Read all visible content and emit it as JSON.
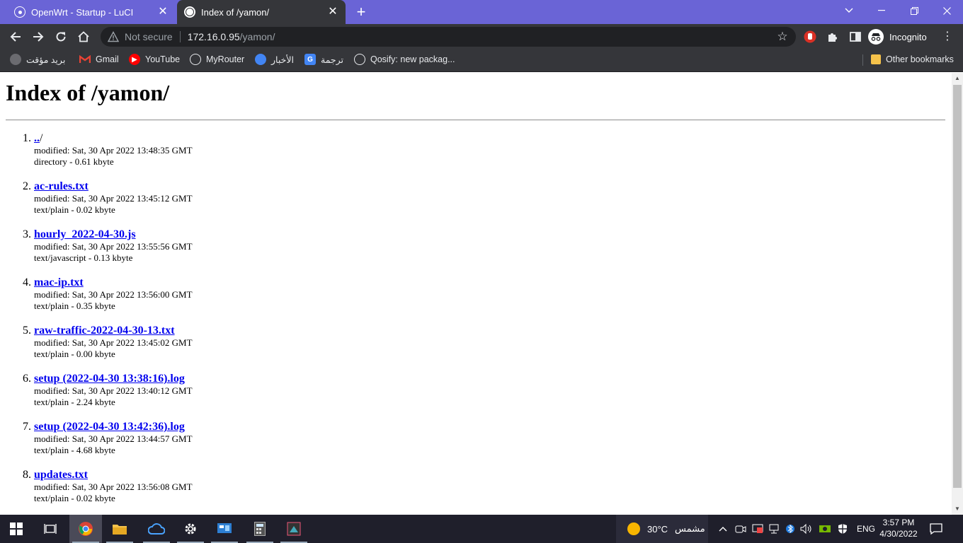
{
  "browser": {
    "tabs": [
      {
        "title": "OpenWrt - Startup - LuCI",
        "active": false
      },
      {
        "title": "Index of /yamon/",
        "active": true
      }
    ],
    "address": {
      "security": "Not secure",
      "host": "172.16.0.95",
      "path": "/yamon/"
    },
    "profile": "Incognito",
    "bookmarks": [
      {
        "label": "بريد مؤقت",
        "icon": "globe-icon"
      },
      {
        "label": "Gmail",
        "icon": "gmail-icon"
      },
      {
        "label": "YouTube",
        "icon": "youtube-icon"
      },
      {
        "label": "MyRouter",
        "icon": "router-icon"
      },
      {
        "label": "الأخبار",
        "icon": "news-icon"
      },
      {
        "label": "ترجمة",
        "icon": "translate-icon"
      },
      {
        "label": "Qosify: new packag...",
        "icon": "openwrt-icon"
      }
    ],
    "other_bookmarks": "Other bookmarks"
  },
  "page": {
    "title": "Index of /yamon/",
    "entries": [
      {
        "num": "1.",
        "name": "..",
        "suffix": "/",
        "modified": "modified: Sat, 30 Apr 2022 13:48:35 GMT",
        "info": "directory - 0.61 kbyte"
      },
      {
        "num": "2.",
        "name": "ac-rules.txt",
        "suffix": "",
        "modified": "modified: Sat, 30 Apr 2022 13:45:12 GMT",
        "info": "text/plain - 0.02 kbyte"
      },
      {
        "num": "3.",
        "name": "hourly_2022-04-30.js",
        "suffix": "",
        "modified": "modified: Sat, 30 Apr 2022 13:55:56 GMT",
        "info": "text/javascript - 0.13 kbyte"
      },
      {
        "num": "4.",
        "name": "mac-ip.txt",
        "suffix": "",
        "modified": "modified: Sat, 30 Apr 2022 13:56:00 GMT",
        "info": "text/plain - 0.35 kbyte"
      },
      {
        "num": "5.",
        "name": "raw-traffic-2022-04-30-13.txt",
        "suffix": "",
        "modified": "modified: Sat, 30 Apr 2022 13:45:02 GMT",
        "info": "text/plain - 0.00 kbyte"
      },
      {
        "num": "6.",
        "name": "setup (2022-04-30 13:38:16).log",
        "suffix": "",
        "modified": "modified: Sat, 30 Apr 2022 13:40:12 GMT",
        "info": "text/plain - 2.24 kbyte"
      },
      {
        "num": "7.",
        "name": "setup (2022-04-30 13:42:36).log",
        "suffix": "",
        "modified": "modified: Sat, 30 Apr 2022 13:44:57 GMT",
        "info": "text/plain - 4.68 kbyte"
      },
      {
        "num": "8.",
        "name": "updates.txt",
        "suffix": "",
        "modified": "modified: Sat, 30 Apr 2022 13:56:08 GMT",
        "info": "text/plain - 0.02 kbyte"
      }
    ]
  },
  "taskbar": {
    "weather": {
      "temp": "30°C",
      "condition": "مشمس"
    },
    "language": "ENG",
    "time": "3:57 PM",
    "date": "4/30/2022"
  }
}
